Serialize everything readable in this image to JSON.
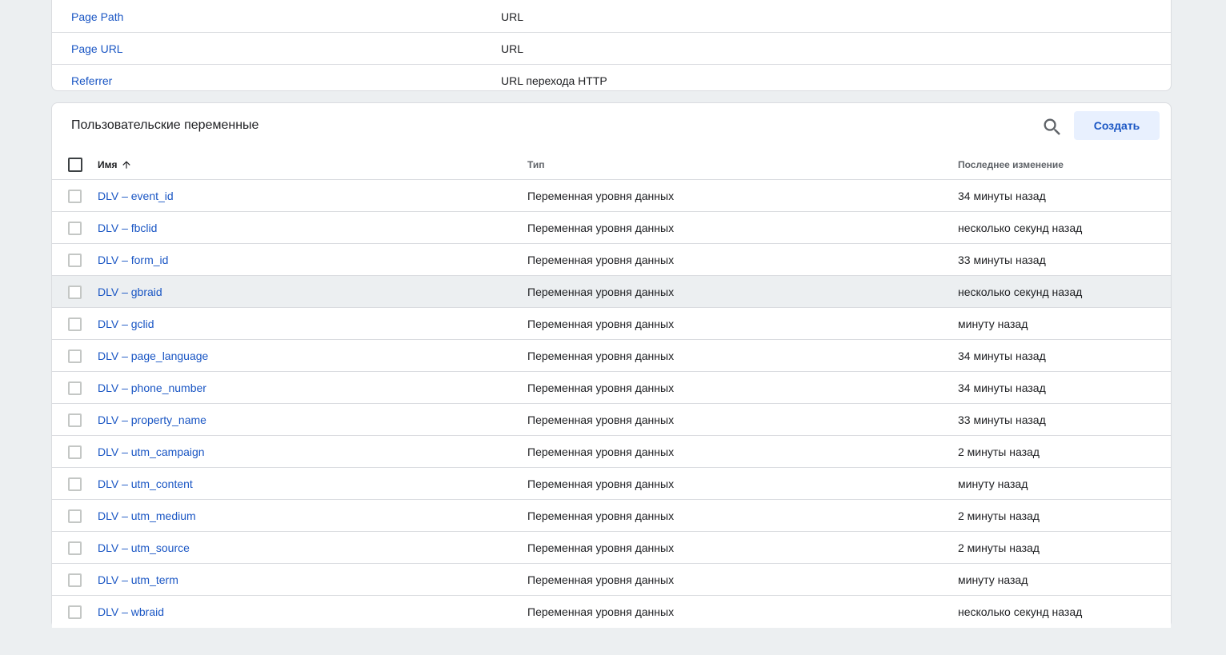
{
  "builtin_variables": [
    {
      "name": "Page Path",
      "type": "URL"
    },
    {
      "name": "Page URL",
      "type": "URL"
    },
    {
      "name": "Referrer",
      "type": "URL перехода HTTP"
    }
  ],
  "user_variables": {
    "title": "Пользовательские переменные",
    "create_label": "Создать",
    "columns": {
      "name": "Имя",
      "type": "Тип",
      "modified": "Последнее изменение"
    },
    "rows": [
      {
        "name": "DLV – event_id",
        "type": "Переменная уровня данных",
        "modified": "34 минуты назад"
      },
      {
        "name": "DLV – fbclid",
        "type": "Переменная уровня данных",
        "modified": "несколько секунд назад"
      },
      {
        "name": "DLV – form_id",
        "type": "Переменная уровня данных",
        "modified": "33 минуты назад"
      },
      {
        "name": "DLV – gbraid",
        "type": "Переменная уровня данных",
        "modified": "несколько секунд назад"
      },
      {
        "name": "DLV – gclid",
        "type": "Переменная уровня данных",
        "modified": "минуту назад"
      },
      {
        "name": "DLV – page_language",
        "type": "Переменная уровня данных",
        "modified": "34 минуты назад"
      },
      {
        "name": "DLV – phone_number",
        "type": "Переменная уровня данных",
        "modified": "34 минуты назад"
      },
      {
        "name": "DLV – property_name",
        "type": "Переменная уровня данных",
        "modified": "33 минуты назад"
      },
      {
        "name": "DLV – utm_campaign",
        "type": "Переменная уровня данных",
        "modified": "2 минуты назад"
      },
      {
        "name": "DLV – utm_content",
        "type": "Переменная уровня данных",
        "modified": "минуту назад"
      },
      {
        "name": "DLV – utm_medium",
        "type": "Переменная уровня данных",
        "modified": "2 минуты назад"
      },
      {
        "name": "DLV – utm_source",
        "type": "Переменная уровня данных",
        "modified": "2 минуты назад"
      },
      {
        "name": "DLV – utm_term",
        "type": "Переменная уровня данных",
        "modified": "минуту назад"
      },
      {
        "name": "DLV – wbraid",
        "type": "Переменная уровня данных",
        "modified": "несколько секунд назад"
      }
    ],
    "hovered_row_index": 3
  },
  "icons": {
    "search": "search-icon",
    "sort": "arrow-up-icon"
  },
  "colors": {
    "link": "#1a56c4",
    "page_background": "#eceff1",
    "primary_button_bg": "#e8f0fe"
  }
}
